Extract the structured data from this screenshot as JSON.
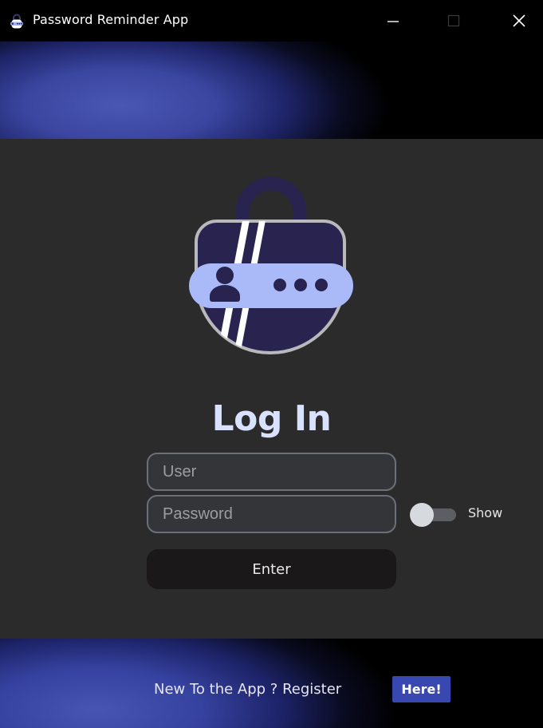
{
  "window": {
    "title": "Password Reminder App",
    "app_icon": "lock-key-icon",
    "controls": {
      "minimize": "minimize-icon",
      "maximize": "maximize-icon",
      "close": "close-icon"
    }
  },
  "colors": {
    "accent": "#3947b1",
    "title_color": "#d8e2ff",
    "panel_bg": "#2b2b2b",
    "logo_lock_body": "#29244f",
    "logo_key": "#aab9f7"
  },
  "login": {
    "logo_icon": "padlock-key-logo-icon",
    "title": "Log In",
    "user_placeholder": "User",
    "password_placeholder": "Password",
    "show_label": "Show",
    "show_toggle_on": false,
    "enter_label": "Enter"
  },
  "footer": {
    "text": "New To the App ? Register",
    "here_label": "Here!"
  }
}
